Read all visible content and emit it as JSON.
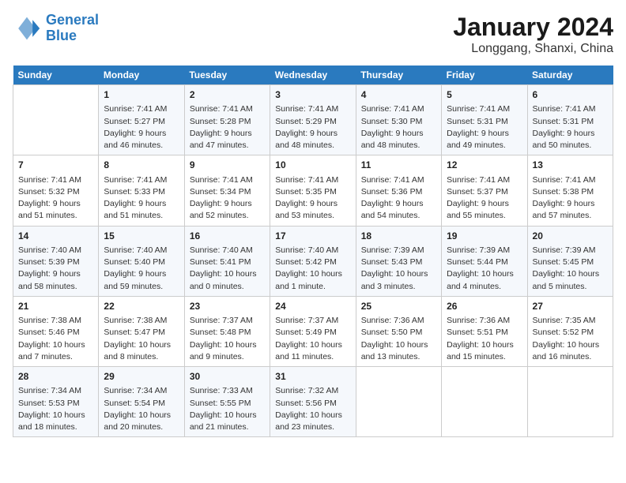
{
  "logo": {
    "line1": "General",
    "line2": "Blue"
  },
  "title": "January 2024",
  "subtitle": "Longgang, Shanxi, China",
  "days_header": [
    "Sunday",
    "Monday",
    "Tuesday",
    "Wednesday",
    "Thursday",
    "Friday",
    "Saturday"
  ],
  "weeks": [
    [
      {
        "day": "",
        "sunrise": "",
        "sunset": "",
        "daylight": ""
      },
      {
        "day": "1",
        "sunrise": "Sunrise: 7:41 AM",
        "sunset": "Sunset: 5:27 PM",
        "daylight": "Daylight: 9 hours and 46 minutes."
      },
      {
        "day": "2",
        "sunrise": "Sunrise: 7:41 AM",
        "sunset": "Sunset: 5:28 PM",
        "daylight": "Daylight: 9 hours and 47 minutes."
      },
      {
        "day": "3",
        "sunrise": "Sunrise: 7:41 AM",
        "sunset": "Sunset: 5:29 PM",
        "daylight": "Daylight: 9 hours and 48 minutes."
      },
      {
        "day": "4",
        "sunrise": "Sunrise: 7:41 AM",
        "sunset": "Sunset: 5:30 PM",
        "daylight": "Daylight: 9 hours and 48 minutes."
      },
      {
        "day": "5",
        "sunrise": "Sunrise: 7:41 AM",
        "sunset": "Sunset: 5:31 PM",
        "daylight": "Daylight: 9 hours and 49 minutes."
      },
      {
        "day": "6",
        "sunrise": "Sunrise: 7:41 AM",
        "sunset": "Sunset: 5:31 PM",
        "daylight": "Daylight: 9 hours and 50 minutes."
      }
    ],
    [
      {
        "day": "7",
        "sunrise": "Sunrise: 7:41 AM",
        "sunset": "Sunset: 5:32 PM",
        "daylight": "Daylight: 9 hours and 51 minutes."
      },
      {
        "day": "8",
        "sunrise": "Sunrise: 7:41 AM",
        "sunset": "Sunset: 5:33 PM",
        "daylight": "Daylight: 9 hours and 51 minutes."
      },
      {
        "day": "9",
        "sunrise": "Sunrise: 7:41 AM",
        "sunset": "Sunset: 5:34 PM",
        "daylight": "Daylight: 9 hours and 52 minutes."
      },
      {
        "day": "10",
        "sunrise": "Sunrise: 7:41 AM",
        "sunset": "Sunset: 5:35 PM",
        "daylight": "Daylight: 9 hours and 53 minutes."
      },
      {
        "day": "11",
        "sunrise": "Sunrise: 7:41 AM",
        "sunset": "Sunset: 5:36 PM",
        "daylight": "Daylight: 9 hours and 54 minutes."
      },
      {
        "day": "12",
        "sunrise": "Sunrise: 7:41 AM",
        "sunset": "Sunset: 5:37 PM",
        "daylight": "Daylight: 9 hours and 55 minutes."
      },
      {
        "day": "13",
        "sunrise": "Sunrise: 7:41 AM",
        "sunset": "Sunset: 5:38 PM",
        "daylight": "Daylight: 9 hours and 57 minutes."
      }
    ],
    [
      {
        "day": "14",
        "sunrise": "Sunrise: 7:40 AM",
        "sunset": "Sunset: 5:39 PM",
        "daylight": "Daylight: 9 hours and 58 minutes."
      },
      {
        "day": "15",
        "sunrise": "Sunrise: 7:40 AM",
        "sunset": "Sunset: 5:40 PM",
        "daylight": "Daylight: 9 hours and 59 minutes."
      },
      {
        "day": "16",
        "sunrise": "Sunrise: 7:40 AM",
        "sunset": "Sunset: 5:41 PM",
        "daylight": "Daylight: 10 hours and 0 minutes."
      },
      {
        "day": "17",
        "sunrise": "Sunrise: 7:40 AM",
        "sunset": "Sunset: 5:42 PM",
        "daylight": "Daylight: 10 hours and 1 minute."
      },
      {
        "day": "18",
        "sunrise": "Sunrise: 7:39 AM",
        "sunset": "Sunset: 5:43 PM",
        "daylight": "Daylight: 10 hours and 3 minutes."
      },
      {
        "day": "19",
        "sunrise": "Sunrise: 7:39 AM",
        "sunset": "Sunset: 5:44 PM",
        "daylight": "Daylight: 10 hours and 4 minutes."
      },
      {
        "day": "20",
        "sunrise": "Sunrise: 7:39 AM",
        "sunset": "Sunset: 5:45 PM",
        "daylight": "Daylight: 10 hours and 5 minutes."
      }
    ],
    [
      {
        "day": "21",
        "sunrise": "Sunrise: 7:38 AM",
        "sunset": "Sunset: 5:46 PM",
        "daylight": "Daylight: 10 hours and 7 minutes."
      },
      {
        "day": "22",
        "sunrise": "Sunrise: 7:38 AM",
        "sunset": "Sunset: 5:47 PM",
        "daylight": "Daylight: 10 hours and 8 minutes."
      },
      {
        "day": "23",
        "sunrise": "Sunrise: 7:37 AM",
        "sunset": "Sunset: 5:48 PM",
        "daylight": "Daylight: 10 hours and 9 minutes."
      },
      {
        "day": "24",
        "sunrise": "Sunrise: 7:37 AM",
        "sunset": "Sunset: 5:49 PM",
        "daylight": "Daylight: 10 hours and 11 minutes."
      },
      {
        "day": "25",
        "sunrise": "Sunrise: 7:36 AM",
        "sunset": "Sunset: 5:50 PM",
        "daylight": "Daylight: 10 hours and 13 minutes."
      },
      {
        "day": "26",
        "sunrise": "Sunrise: 7:36 AM",
        "sunset": "Sunset: 5:51 PM",
        "daylight": "Daylight: 10 hours and 15 minutes."
      },
      {
        "day": "27",
        "sunrise": "Sunrise: 7:35 AM",
        "sunset": "Sunset: 5:52 PM",
        "daylight": "Daylight: 10 hours and 16 minutes."
      }
    ],
    [
      {
        "day": "28",
        "sunrise": "Sunrise: 7:34 AM",
        "sunset": "Sunset: 5:53 PM",
        "daylight": "Daylight: 10 hours and 18 minutes."
      },
      {
        "day": "29",
        "sunrise": "Sunrise: 7:34 AM",
        "sunset": "Sunset: 5:54 PM",
        "daylight": "Daylight: 10 hours and 20 minutes."
      },
      {
        "day": "30",
        "sunrise": "Sunrise: 7:33 AM",
        "sunset": "Sunset: 5:55 PM",
        "daylight": "Daylight: 10 hours and 21 minutes."
      },
      {
        "day": "31",
        "sunrise": "Sunrise: 7:32 AM",
        "sunset": "Sunset: 5:56 PM",
        "daylight": "Daylight: 10 hours and 23 minutes."
      },
      {
        "day": "",
        "sunrise": "",
        "sunset": "",
        "daylight": ""
      },
      {
        "day": "",
        "sunrise": "",
        "sunset": "",
        "daylight": ""
      },
      {
        "day": "",
        "sunrise": "",
        "sunset": "",
        "daylight": ""
      }
    ]
  ]
}
